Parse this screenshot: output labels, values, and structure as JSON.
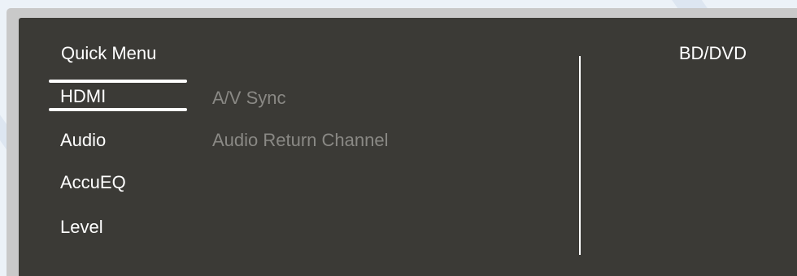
{
  "menu": {
    "title": "Quick Menu",
    "items": [
      {
        "label": "HDMI",
        "selected": true
      },
      {
        "label": "Audio",
        "selected": false
      },
      {
        "label": "AccuEQ",
        "selected": false
      },
      {
        "label": "Level",
        "selected": false
      }
    ]
  },
  "submenu": {
    "items": [
      {
        "label": "A/V Sync"
      },
      {
        "label": "Audio Return Channel"
      }
    ]
  },
  "source": {
    "label": "BD/DVD"
  },
  "colors": {
    "panel_bg": "#3b3a36",
    "frame": "#c9c9c9",
    "text_active": "#ffffff",
    "text_inactive": "#8a8985",
    "page_bg": "#ecf2f8"
  }
}
